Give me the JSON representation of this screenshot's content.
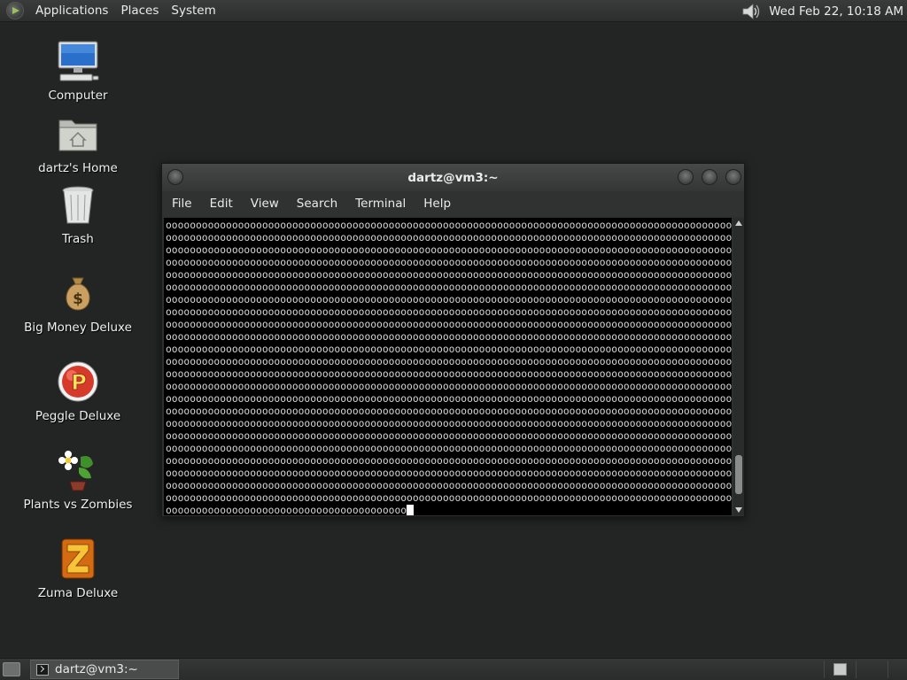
{
  "top_panel": {
    "menus": [
      "Applications",
      "Places",
      "System"
    ],
    "clock": "Wed Feb 22, 10:18 AM",
    "icons": [
      "distro-logo-icon",
      "volume-icon"
    ]
  },
  "desktop_icons": [
    {
      "label": "Computer",
      "icon": "computer-icon"
    },
    {
      "label": "dartz's Home",
      "icon": "home-folder-icon"
    },
    {
      "label": "Trash",
      "icon": "trash-icon"
    },
    {
      "label": "Big Money Deluxe",
      "icon": "money-bag-icon"
    },
    {
      "label": "Peggle Deluxe",
      "icon": "peggle-icon"
    },
    {
      "label": "Plants vs Zombies",
      "icon": "plants-icon"
    },
    {
      "label": "Zuma Deluxe",
      "icon": "zuma-icon"
    }
  ],
  "terminal": {
    "title": "dartz@vm3:~",
    "menus": [
      "File",
      "Edit",
      "View",
      "Search",
      "Terminal",
      "Help"
    ],
    "full_line": "oooooooooooooooooooooooooooooooooooooooooooooooooooooooooooooooooooooooooooooooooooooooooooooooooooooooooooooo",
    "line_count": 23,
    "last_line": "oooooooooooooooooooooooooooooooooooooooo",
    "scroll_position": 0.95
  },
  "bottom_panel": {
    "task_label": "dartz@vm3:~",
    "colors": {
      "workspace_active": "#c9cbca"
    }
  }
}
